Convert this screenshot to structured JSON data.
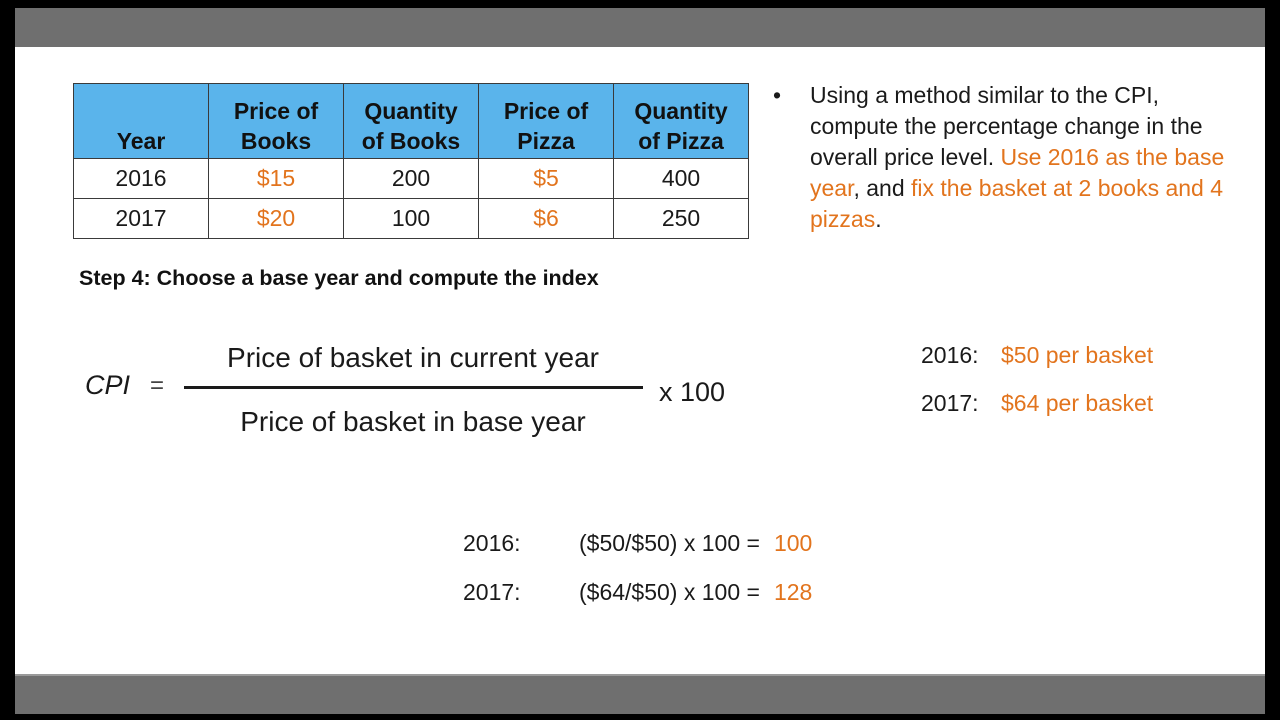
{
  "table": {
    "headers": [
      {
        "line1": "",
        "line2": "Year"
      },
      {
        "line1": "Price of",
        "line2": "Books"
      },
      {
        "line1": "Quantity",
        "line2": "of Books"
      },
      {
        "line1": "Price of",
        "line2": "Pizza"
      },
      {
        "line1": "Quantity",
        "line2": "of Pizza"
      }
    ],
    "rows": [
      {
        "year": "2016",
        "price_books": "$15",
        "qty_books": "200",
        "price_pizza": "$5",
        "qty_pizza": "400"
      },
      {
        "year": "2017",
        "price_books": "$20",
        "qty_books": "100",
        "price_pizza": "$6",
        "qty_pizza": "250"
      }
    ],
    "header_color": "#5ab4eb",
    "price_color": "#e2741d"
  },
  "bullet": {
    "marker": "•",
    "text_part1": "Using a method similar to the CPI, compute the percentage change in the overall price level.  ",
    "highlight1": "Use 2016 as the base year",
    "text_part2": ", and ",
    "highlight2": "fix the basket at 2 books and 4 pizzas",
    "text_part3": "."
  },
  "step_heading": "Step 4: Choose a base year and compute the index",
  "formula": {
    "lhs": "CPI",
    "equals": "=",
    "numerator": "Price of basket in current year",
    "denominator": "Price of basket in base year",
    "multiplier": "x  100"
  },
  "basket_prices": [
    {
      "year": "2016:",
      "value": "$50 per basket"
    },
    {
      "year": "2017:",
      "value": "$64 per basket"
    }
  ],
  "computations": [
    {
      "year": "2016:",
      "expression": "($50/$50) x 100 =",
      "result": "100"
    },
    {
      "year": "2017:",
      "expression": "($64/$50) x 100 =",
      "result": "128"
    }
  ],
  "colors": {
    "accent_orange": "#e2741d",
    "bar_gray": "#6f6f6f"
  }
}
